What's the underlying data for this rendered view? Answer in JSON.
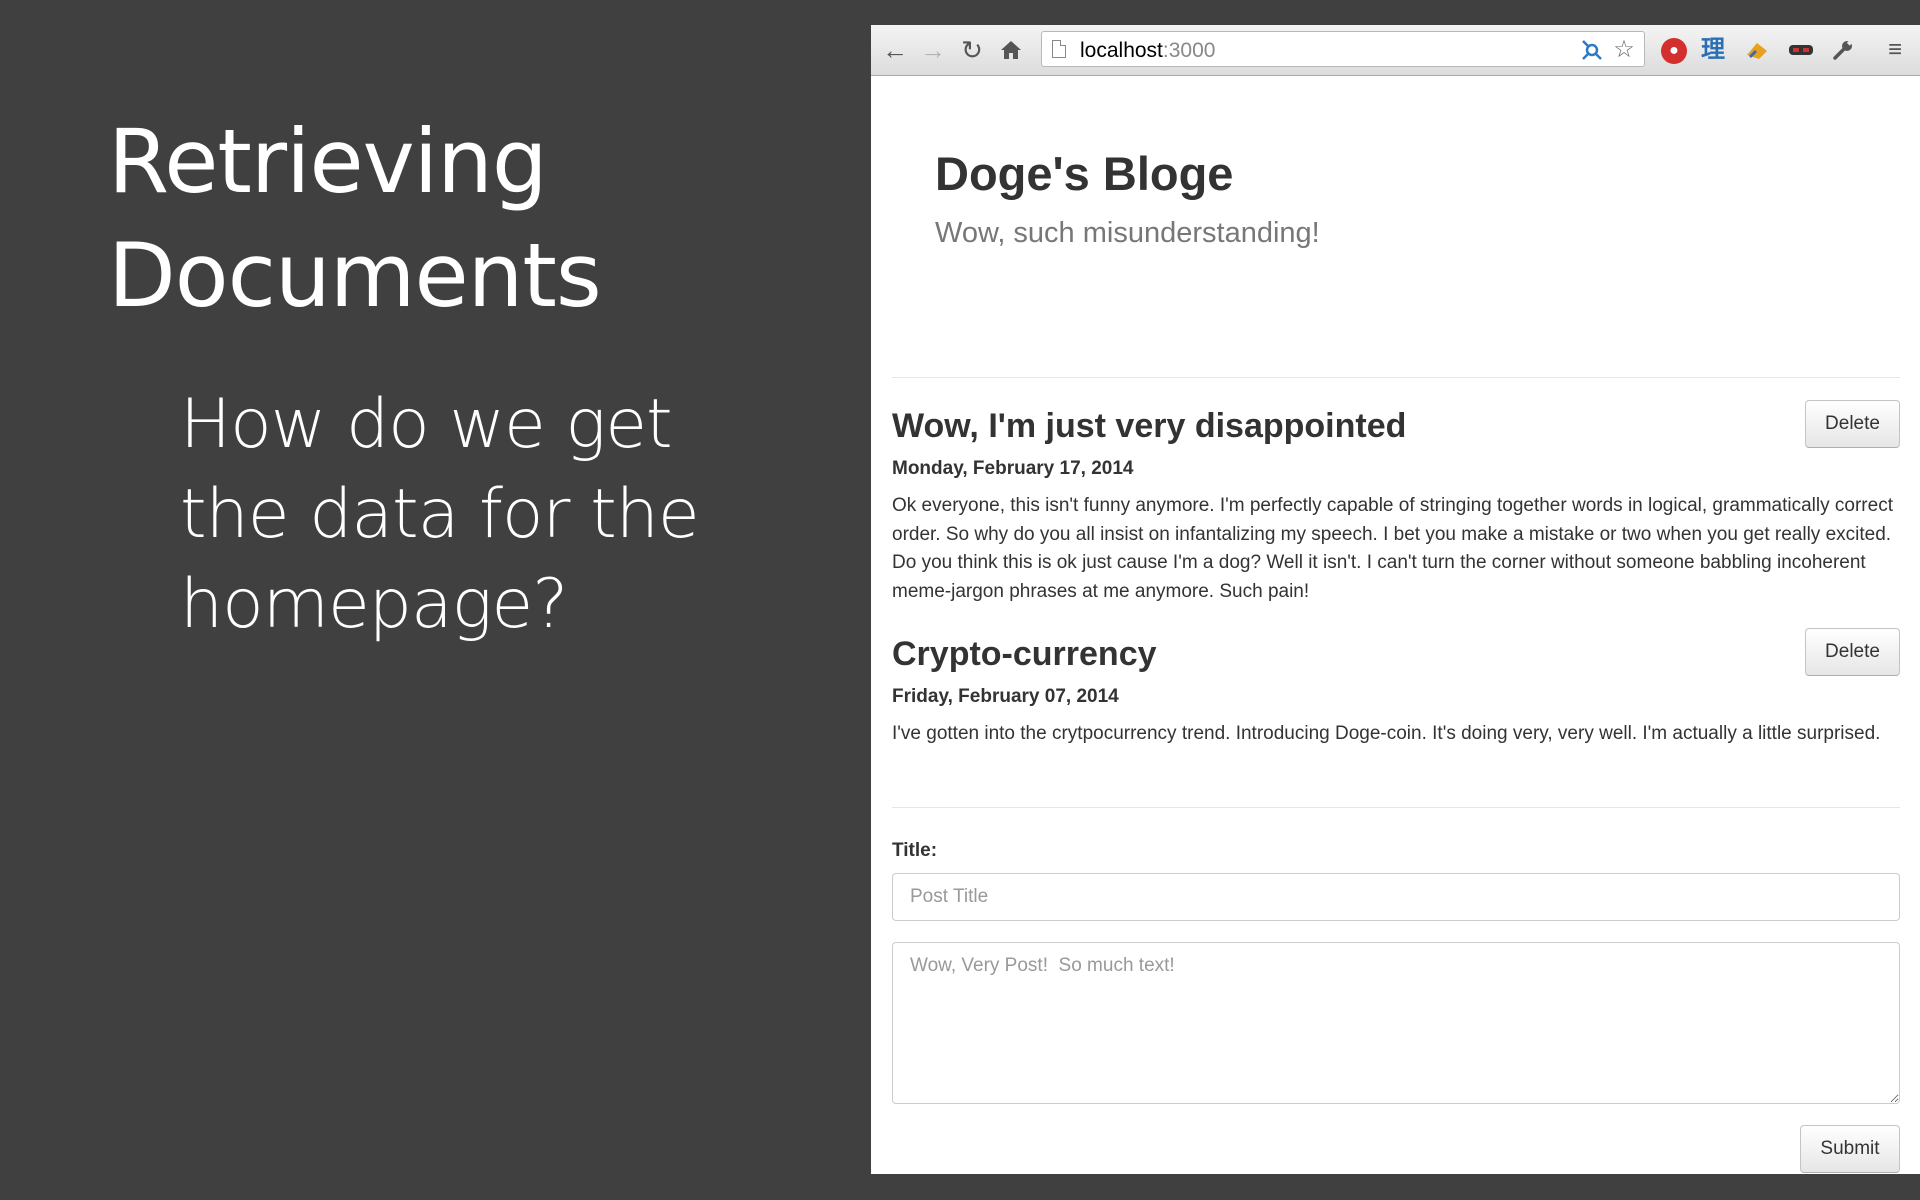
{
  "slide": {
    "title_lines": [
      "Retrieving",
      "Documents"
    ],
    "body_lines": [
      "How do we get",
      "the data for the",
      "homepage?"
    ]
  },
  "browser": {
    "toolbar": {
      "back_icon": "arrow-left-icon",
      "forward_icon": "arrow-right-icon",
      "reload_icon": "reload-icon",
      "home_icon": "home-icon",
      "url_host": "localhost",
      "url_port": ":3000",
      "extensions": [
        "network-extension-icon",
        "star-icon",
        "stop-extension-icon",
        "translate-extension-icon",
        "fox-extension-icon",
        "mask-extension-icon",
        "wrench-icon",
        "menu-icon"
      ],
      "translate_glyph": "理"
    },
    "page": {
      "blog_title": "Doge's Bloge",
      "blog_subtitle": "Wow, such misunderstanding!",
      "posts": [
        {
          "title": "Wow, I'm just very disappointed",
          "date": "Monday, February 17, 2014",
          "body": "Ok everyone, this isn't funny anymore. I'm perfectly capable of stringing together words in logical, grammatically correct order. So why do you all insist on infantalizing my speech. I bet you make a mistake or two when you get really excited. Do you think this is ok just cause I'm a dog? Well it isn't. I can't turn the corner without someone babbling incoherent meme-jargon phrases at me anymore. Such pain!",
          "delete_label": "Delete"
        },
        {
          "title": "Crypto-currency",
          "date": "Friday, February 07, 2014",
          "body": "I've gotten into the crytpocurrency trend. Introducing Doge-coin. It's doing very, very well. I'm actually a little surprised.",
          "delete_label": "Delete"
        }
      ],
      "form": {
        "title_label": "Title:",
        "title_placeholder": "Post Title",
        "title_value": "",
        "body_placeholder": "Wow, Very Post!  So much text!",
        "body_value": "",
        "submit_label": "Submit"
      }
    }
  },
  "colors": {
    "slide_background": "#404040",
    "slide_text": "#ffffff",
    "blog_heading": "#333333",
    "blog_subtitle": "#777777"
  }
}
